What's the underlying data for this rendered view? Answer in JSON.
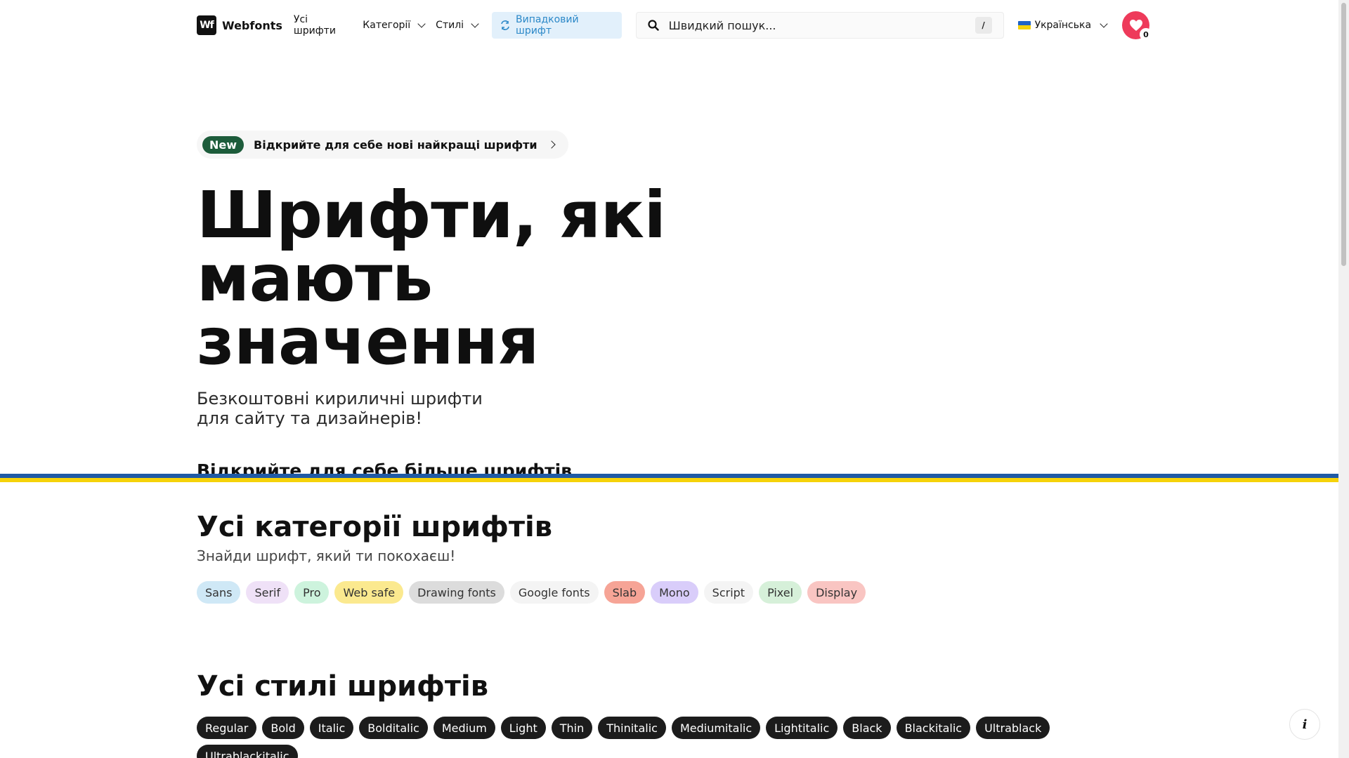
{
  "header": {
    "logo_mark": "Wf",
    "logo_text": "Webfonts",
    "nav": {
      "all_fonts": "Усі шрифти",
      "categories": "Категорії",
      "styles": "Стилі"
    },
    "random_font": "Випадковий шрифт",
    "search_placeholder": "Швидкий пошук...",
    "search_shortcut": "/",
    "language": "Українська",
    "favorites_count": "0"
  },
  "hero": {
    "promo_badge": "New",
    "promo_text": "Відкрийте для себе нові найкращі шрифти",
    "title_line1": "Шрифти, які",
    "title_line2": "мають значення",
    "subtitle_line1": "Безкоштовні кириличні шрифти",
    "subtitle_line2": "для сайту та дизайнерів!",
    "more_link": "Відкрийте для себе більше шрифтів"
  },
  "categories_section": {
    "title": "Усі категорії шрифтів",
    "subtitle": "Знайди шрифт, який ти покохаєш!",
    "chips": [
      {
        "label": "Sans",
        "color": "#cfe8f6"
      },
      {
        "label": "Serif",
        "color": "#efe1f7"
      },
      {
        "label": "Pro",
        "color": "#cdf3dd"
      },
      {
        "label": "Web safe",
        "color": "#fbe98f"
      },
      {
        "label": "Drawing fonts",
        "color": "#dcdcdc"
      },
      {
        "label": "Google fonts",
        "color": "#f4f4f4"
      },
      {
        "label": "Slab",
        "color": "#f6a496"
      },
      {
        "label": "Mono",
        "color": "#d9cdfa"
      },
      {
        "label": "Script",
        "color": "#f4f4f4"
      },
      {
        "label": "Pixel",
        "color": "#d6f0d9"
      },
      {
        "label": "Display",
        "color": "#f9c5c2"
      }
    ]
  },
  "styles_section": {
    "title": "Усі стилі шрифтів",
    "chips": [
      "Regular",
      "Bold",
      "Italic",
      "Bolditalic",
      "Medium",
      "Light",
      "Thin",
      "Thinitalic",
      "Mediumitalic",
      "Lightitalic",
      "Black",
      "Blackitalic",
      "Ultrablack",
      "Ultrablackitalic"
    ]
  },
  "info_button": "i",
  "colors": {
    "accent_blue": "#2b88c8",
    "heart_red": "#ee3a5a",
    "ukraine_blue": "#1f5aa5",
    "ukraine_yellow": "#f5d20a"
  }
}
